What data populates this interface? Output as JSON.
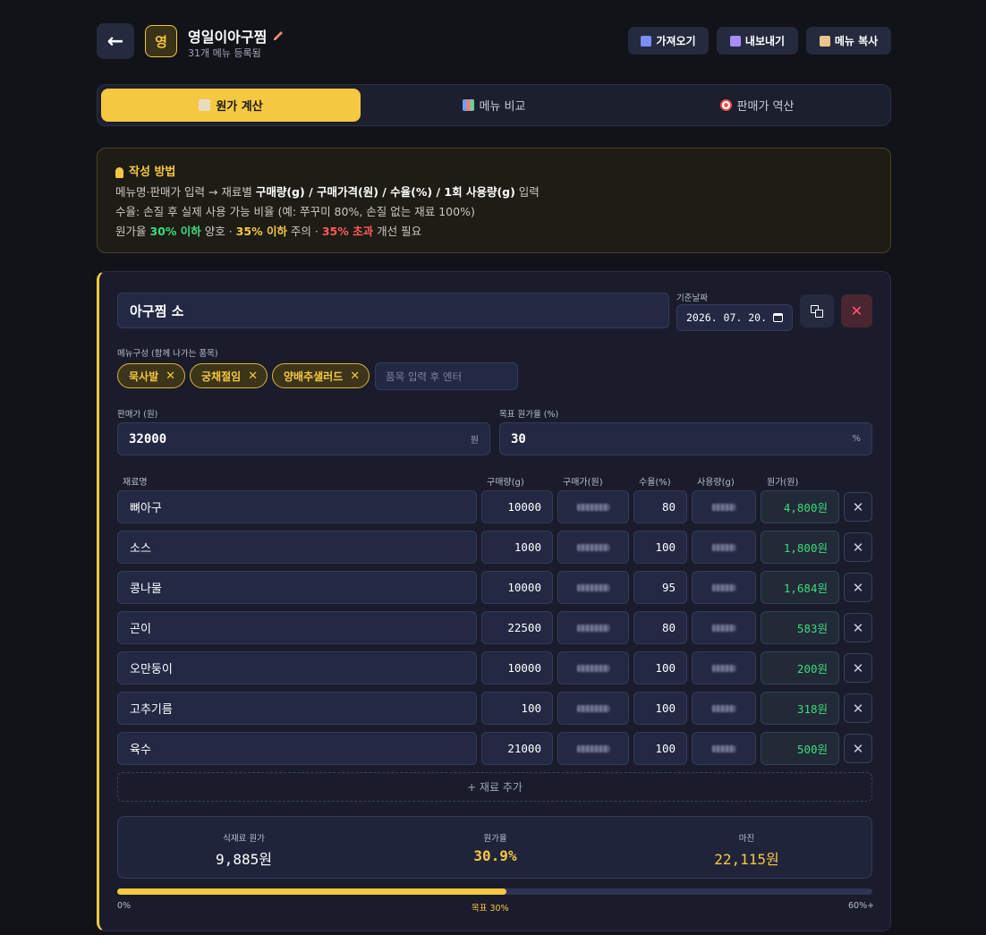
{
  "header": {
    "back_icon": "arrow-left-icon",
    "logo_char": "영",
    "store_name": "영일이아구찜",
    "store_sub": "31개 메뉴 등록됨",
    "buttons": [
      {
        "label": "가져오기",
        "icon": "inbox-icon",
        "color": "#7b8cff"
      },
      {
        "label": "내보내기",
        "icon": "floppy-icon",
        "color": "#a98cff"
      },
      {
        "label": "메뉴 복사",
        "icon": "clipboard-icon",
        "color": "#e9c58a"
      }
    ]
  },
  "tabs": [
    {
      "label": "원가 계산",
      "icon": "clipboard-icon",
      "active": true
    },
    {
      "label": "메뉴 비교",
      "icon": "chart-icon",
      "active": false
    },
    {
      "label": "판매가 역산",
      "icon": "target-icon",
      "active": false
    }
  ],
  "guide": {
    "title": "작성 방법",
    "line1_a": "메뉴명·판매가 입력 → 재료별 ",
    "line1_b": "구매량(g) / 구매가격(원) / 수율(%) / 1회 사용량(g)",
    "line1_c": " 입력",
    "line2": "수율: 손질 후 실제 사용 가능 비율 (예: 쭈꾸미 80%, 손질 없는 재료 100%)",
    "line3_a": "원가율 ",
    "line3_green": "30% 이하",
    "line3_b": " 양호 · ",
    "line3_yellow": "35% 이하",
    "line3_c": " 주의 · ",
    "line3_red": "35% 초과",
    "line3_d": " 개선 필요"
  },
  "menu": {
    "name": "아구찜 소",
    "date_label": "기준날짜",
    "date_value": "2026. 07. 20.",
    "composition_label": "메뉴구성 (함께 나가는 품목)",
    "chips": [
      "묵사발",
      "궁채절임",
      "양배추샐러드"
    ],
    "chip_placeholder": "품목 입력 후 엔터",
    "price_label": "판매가 (원)",
    "price_value": "32000",
    "price_unit": "원",
    "target_label": "목표 원가율 (%)",
    "target_value": "30",
    "target_unit": "%"
  },
  "table": {
    "headers": [
      "재료명",
      "구매량(g)",
      "구매가(원)",
      "수율(%)",
      "사용량(g)",
      "원가(원)"
    ],
    "rows": [
      {
        "name": "뼈아구",
        "qty": "10000",
        "yield": "80",
        "cost": "4,800원"
      },
      {
        "name": "소스",
        "qty": "1000",
        "yield": "100",
        "cost": "1,800원"
      },
      {
        "name": "콩나물",
        "qty": "10000",
        "yield": "95",
        "cost": "1,684원"
      },
      {
        "name": "곤이",
        "qty": "22500",
        "yield": "80",
        "cost": "583원"
      },
      {
        "name": "오만둥이",
        "qty": "10000",
        "yield": "100",
        "cost": "200원"
      },
      {
        "name": "고추기름",
        "qty": "100",
        "yield": "100",
        "cost": "318원"
      },
      {
        "name": "육수",
        "qty": "21000",
        "yield": "100",
        "cost": "500원"
      }
    ],
    "add_label": "+ 재료 추가"
  },
  "summary": {
    "food_cost_label": "식재료 원가",
    "food_cost_value": "9,885원",
    "cost_rate_label": "원가율",
    "cost_rate_value": "30.9%",
    "margin_label": "마진",
    "margin_value": "22,115원"
  },
  "progress": {
    "fraction": 0.515,
    "min_label": "0%",
    "target_label": "목표 30%",
    "max_label": "60%+"
  }
}
